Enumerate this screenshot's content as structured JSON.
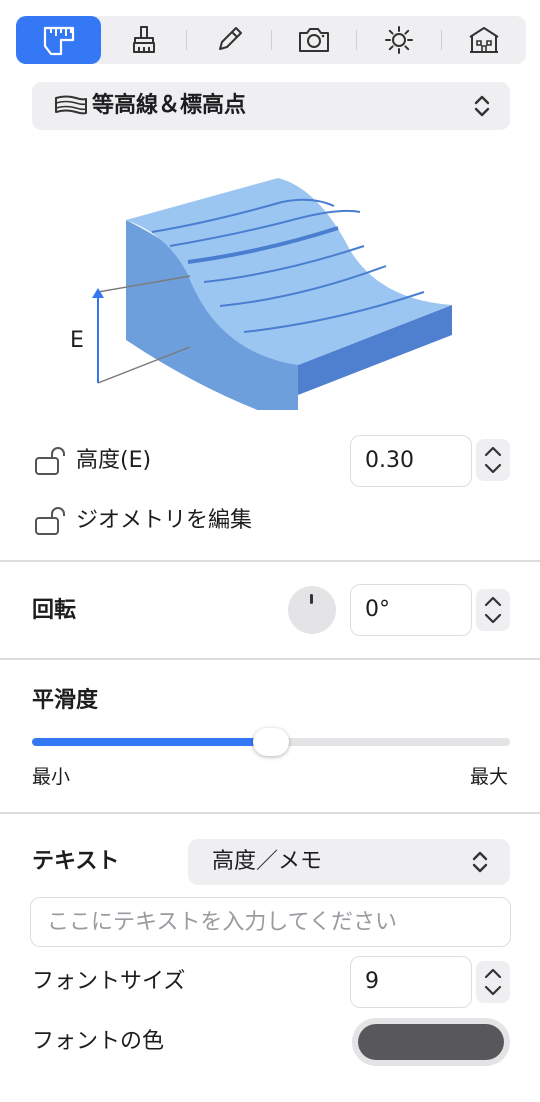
{
  "toolbar": {
    "tabs": [
      {
        "icon": "ruler-shape-icon",
        "active": true
      },
      {
        "icon": "paintbrush-icon",
        "active": false
      },
      {
        "icon": "pencil-icon",
        "active": false
      },
      {
        "icon": "camera-icon",
        "active": false
      },
      {
        "icon": "sun-icon",
        "active": false
      },
      {
        "icon": "building-icon",
        "active": false
      }
    ]
  },
  "shape_selector": {
    "label": "等高線＆標高点",
    "icon": "contour-layers-icon"
  },
  "illustration": {
    "axis_label": "E",
    "colors": {
      "top": "#9cc6f2",
      "side": "#6e9fdd",
      "front": "#4f80cf",
      "line": "#4a7ed0"
    }
  },
  "elevation": {
    "label": "高度(E)",
    "value": "0.30"
  },
  "edit_geometry": {
    "label": "ジオメトリを編集"
  },
  "rotation": {
    "label": "回転",
    "value": "0°"
  },
  "smoothness": {
    "label": "平滑度",
    "min_label": "最小",
    "max_label": "最大",
    "value_fraction": 0.5
  },
  "text": {
    "label": "テキスト",
    "mode": "高度／メモ",
    "placeholder": "ここにテキストを入力してください",
    "value": ""
  },
  "font_size": {
    "label": "フォントサイズ",
    "value": "9"
  },
  "font_color": {
    "label": "フォントの色",
    "color": "#58585a"
  },
  "colors": {
    "accent": "#3478f6",
    "control_bg": "#efeff1"
  }
}
